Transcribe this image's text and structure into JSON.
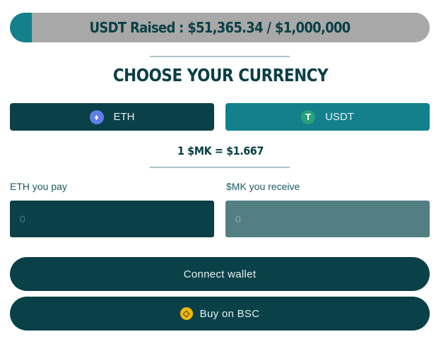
{
  "progress": {
    "label": "USDT Raised : $51,365.34 / $1,000,000",
    "fraction": 0.0514,
    "fill_color": "#13808c",
    "track_color": "#a8a8a8"
  },
  "heading": "CHOOSE YOUR CURRENCY",
  "currency": {
    "eth": {
      "label": "ETH",
      "icon": "ethereum-icon",
      "glyph": "♦"
    },
    "usdt": {
      "label": "USDT",
      "icon": "tether-icon",
      "glyph": "T"
    }
  },
  "rate": "1 $MK = $1.667",
  "form": {
    "pay_label": "ETH you pay",
    "pay_placeholder": "0",
    "receive_label": "$MK you receive",
    "receive_placeholder": "0"
  },
  "buttons": {
    "connect": "Connect wallet",
    "buy_bsc": "Buy on BSC",
    "buy_bsc_icon": "bnb-icon"
  },
  "colors": {
    "primary_dark": "#0a4148",
    "accent_teal": "#13808c",
    "text_dark": "#0a3f45"
  }
}
